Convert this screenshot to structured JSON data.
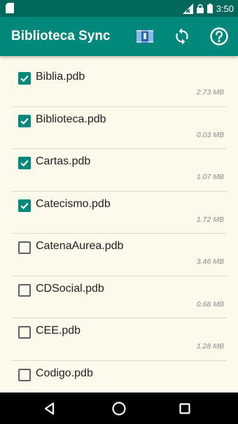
{
  "status_bar": {
    "time": "3:50"
  },
  "app_bar": {
    "title": "Biblioteca Sync"
  },
  "files": [
    {
      "name": "Biblia.pdb",
      "size": "2.73 MB",
      "checked": true
    },
    {
      "name": "Biblioteca.pdb",
      "size": "0.03 MB",
      "checked": true
    },
    {
      "name": "Cartas.pdb",
      "size": "1.07 MB",
      "checked": true
    },
    {
      "name": "Catecismo.pdb",
      "size": "1.72 MB",
      "checked": true
    },
    {
      "name": "CatenaAurea.pdb",
      "size": "3.46 MB",
      "checked": false
    },
    {
      "name": "CDSocial.pdb",
      "size": "0.68 MB",
      "checked": false
    },
    {
      "name": "CEE.pdb",
      "size": "1.28 MB",
      "checked": false
    },
    {
      "name": "Codigo.pdb",
      "size": "",
      "checked": false
    }
  ],
  "colors": {
    "status_bar": "#00695c",
    "app_bar": "#00897b",
    "background": "#fbfaeb",
    "checkbox_checked": "#00897b"
  },
  "icons": {
    "books": "books-icon",
    "sync": "sync-icon",
    "help": "help-icon",
    "back": "back-triangle-icon",
    "home": "home-circle-icon",
    "recent": "recent-square-icon"
  }
}
